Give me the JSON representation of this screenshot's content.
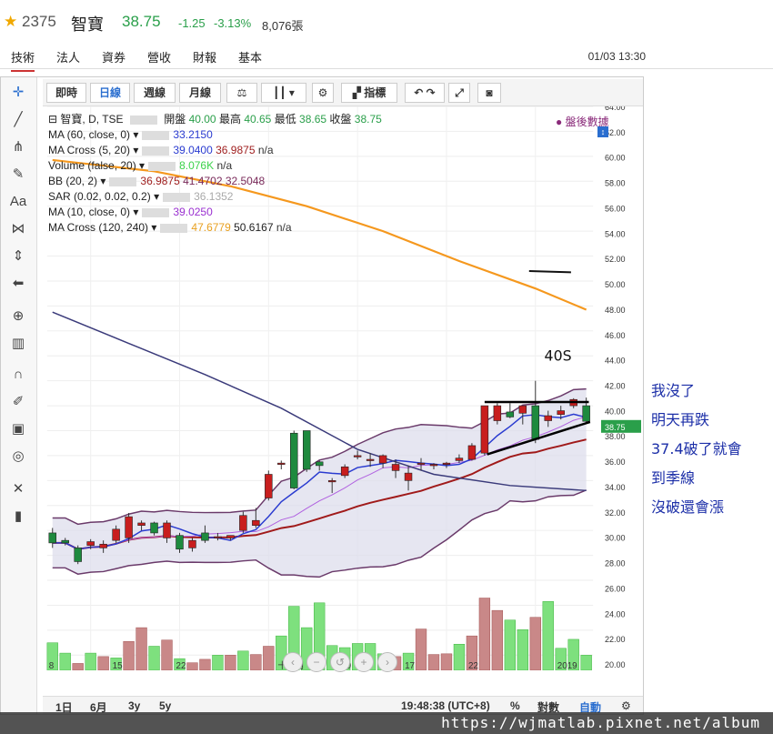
{
  "header": {
    "symbol": "2375",
    "name": "智寶",
    "price": "38.75",
    "change": "-1.25",
    "change_pct": "-3.13%",
    "volume": "8,076張"
  },
  "tabs": [
    "技術",
    "法人",
    "資券",
    "營收",
    "財報",
    "基本"
  ],
  "datetime": "01/03 13:30",
  "toolbar": {
    "buttons": [
      "即時",
      "日線",
      "週線",
      "月線"
    ],
    "indicator_label": "指標"
  },
  "legend": {
    "title": "智寶, D, TSE",
    "ohlc": {
      "open_label": "開盤",
      "open": "40.00",
      "high_label": "最高",
      "high": "40.65",
      "low_label": "最低",
      "low": "38.65",
      "close_label": "收盤",
      "close": "38.75"
    },
    "after_hours": "盤後數據",
    "rows": [
      {
        "name": "MA (60, close, 0)",
        "values": [
          "33.2150"
        ],
        "colors": [
          "#2a3bd0"
        ]
      },
      {
        "name": "MA Cross (5, 20)",
        "values": [
          "39.0400",
          "36.9875",
          "n/a"
        ],
        "colors": [
          "#2a3bd0",
          "#a02020",
          "#333"
        ]
      },
      {
        "name": "Volume (false, 20)",
        "values": [
          "8.076K",
          "n/a"
        ],
        "colors": [
          "#3bd24a",
          "#333"
        ]
      },
      {
        "name": "BB (20, 2)",
        "values": [
          "36.9875",
          "41.4702",
          "32.5048"
        ],
        "colors": [
          "#a02020",
          "#7a2a5a",
          "#7a2a5a"
        ]
      },
      {
        "name": "SAR (0.02, 0.02, 0.2)",
        "values": [
          "36.1352"
        ],
        "colors": [
          "#aaa"
        ]
      },
      {
        "name": "MA (10, close, 0)",
        "values": [
          "39.0250"
        ],
        "colors": [
          "#9a30d0"
        ]
      },
      {
        "name": "MA Cross (120, 240)",
        "values": [
          "47.6779",
          "50.6167",
          "n/a"
        ],
        "colors": [
          "#e8a020",
          "#222",
          "#333"
        ]
      }
    ]
  },
  "chart_data": {
    "type": "candlestick",
    "ylim": [
      19.5,
      64
    ],
    "y_ticks": [
      "64.00",
      "62.00",
      "60.00",
      "58.00",
      "56.00",
      "54.00",
      "52.00",
      "50.00",
      "48.00",
      "46.00",
      "44.00",
      "42.00",
      "40.00",
      "38.00",
      "36.00",
      "34.00",
      "32.00",
      "30.00",
      "28.00",
      "26.00",
      "24.00",
      "22.00",
      "20.00"
    ],
    "last_price_tag": "38.75",
    "x_ticks": [
      "8",
      "15",
      "22",
      "十二月",
      "10",
      "17",
      "22",
      "2019"
    ],
    "candles": [
      [
        29.8,
        30.2,
        28.6,
        29.0
      ],
      [
        29.2,
        29.4,
        28.8,
        29.0
      ],
      [
        28.6,
        28.8,
        27.3,
        27.5
      ],
      [
        28.8,
        29.3,
        28.5,
        29.1
      ],
      [
        28.6,
        29.2,
        28.2,
        28.9
      ],
      [
        29.2,
        30.4,
        29.0,
        30.1
      ],
      [
        29.4,
        31.4,
        29.0,
        31.1
      ],
      [
        30.4,
        30.8,
        30.0,
        30.6
      ],
      [
        30.6,
        30.7,
        29.6,
        29.8
      ],
      [
        29.4,
        30.8,
        29.0,
        30.6
      ],
      [
        29.6,
        29.8,
        28.2,
        28.5
      ],
      [
        28.6,
        29.4,
        28.3,
        29.2
      ],
      [
        29.8,
        30.4,
        29.0,
        29.2
      ],
      [
        29.5,
        29.8,
        29.2,
        29.5
      ],
      [
        29.4,
        29.6,
        29.2,
        29.6
      ],
      [
        30.0,
        31.5,
        29.8,
        31.2
      ],
      [
        30.4,
        31.8,
        30.2,
        30.8
      ],
      [
        32.6,
        34.8,
        32.4,
        34.5
      ],
      [
        35.3,
        35.6,
        34.9,
        35.4
      ],
      [
        37.8,
        38.0,
        33.3,
        33.4
      ],
      [
        38.0,
        38.0,
        34.7,
        34.9
      ],
      [
        35.5,
        35.6,
        34.8,
        35.2
      ],
      [
        34.0,
        34.2,
        33.0,
        34.0
      ],
      [
        34.4,
        35.3,
        34.2,
        35.1
      ],
      [
        36.0,
        36.4,
        35.7,
        36.0
      ],
      [
        35.6,
        36.2,
        35.1,
        35.7
      ],
      [
        35.4,
        36.1,
        35.0,
        36.0
      ],
      [
        34.8,
        35.7,
        34.2,
        35.3
      ],
      [
        34.0,
        35.2,
        33.2,
        34.6
      ],
      [
        35.3,
        35.8,
        34.8,
        35.4
      ],
      [
        35.2,
        35.4,
        34.9,
        35.3
      ],
      [
        35.3,
        35.5,
        35.0,
        35.4
      ],
      [
        35.6,
        36.1,
        35.4,
        35.8
      ],
      [
        35.7,
        37.0,
        35.6,
        36.8
      ],
      [
        36.2,
        40.0,
        36.0,
        40.0
      ],
      [
        38.8,
        40.2,
        38.5,
        40.0
      ],
      [
        39.5,
        40.2,
        39.0,
        39.1
      ],
      [
        39.4,
        40.0,
        38.5,
        40.0
      ],
      [
        40.0,
        42.0,
        37.0,
        37.3
      ],
      [
        38.8,
        39.6,
        38.3,
        39.2
      ],
      [
        39.3,
        40.0,
        38.9,
        39.6
      ],
      [
        40.0,
        40.6,
        39.8,
        40.5
      ],
      [
        40.0,
        40.65,
        38.65,
        38.75
      ]
    ],
    "volume": [
      4,
      2.5,
      1,
      2.5,
      2,
      1.8,
      4.2,
      6.2,
      3.5,
      4.4,
      1.7,
      1.1,
      1.6,
      2.2,
      2.2,
      2.8,
      2.3,
      3.5,
      5,
      9.3,
      6.2,
      9.8,
      3.6,
      3.3,
      3.9,
      3.9,
      2.4,
      2,
      2.5,
      6,
      2.3,
      2.4,
      3.8,
      5,
      10.5,
      8.7,
      7.3,
      5.9,
      7.7,
      10,
      3.2,
      4.5,
      2.2
    ],
    "volume_colors": [
      "g",
      "g",
      "r",
      "g",
      "r",
      "g",
      "r",
      "r",
      "g",
      "r",
      "g",
      "r",
      "r",
      "g",
      "r",
      "g",
      "r",
      "r",
      "g",
      "g",
      "g",
      "g",
      "g",
      "g",
      "g",
      "g",
      "g",
      "r",
      "g",
      "r",
      "r",
      "r",
      "g",
      "r",
      "r",
      "r",
      "g",
      "g",
      "r",
      "g",
      "g",
      "g",
      "g"
    ],
    "annotations": [
      "40S"
    ]
  },
  "annotation_notes": [
    "我沒了",
    "明天再跌",
    "37.4破了就會",
    "到季線",
    "沒破還會漲"
  ],
  "bottom_bar": {
    "ranges": [
      "1日",
      "6月",
      "3y",
      "5y"
    ],
    "clock": "19:48:38 (UTC+8)",
    "percent": "%",
    "log": "對數",
    "auto": "自動"
  },
  "watermark": "https://wjmatlab.pixnet.net/album"
}
